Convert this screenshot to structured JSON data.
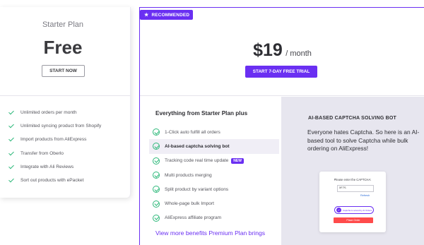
{
  "starter": {
    "name": "Starter Plan",
    "price": "Free",
    "button": "START NOW",
    "features": [
      "Unlimited orders per month",
      "Unlimited syncing product from Shopify",
      "Import products from AliExpress",
      "Transfer from Oberlo",
      "Integrate with Ali Reviews",
      "Sort out products with ePacket"
    ]
  },
  "premium": {
    "badge": "RECOMMENDED",
    "price": "$19",
    "per": "/ month",
    "button": "START 7-DAY FREE TRIAL",
    "plus_title": "Everything from Starter Plan plus",
    "features": [
      {
        "label": "1-Click auto fulfill all orders"
      },
      {
        "label": "AI-based captcha solving bot"
      },
      {
        "label": "Tracking code real time update",
        "tag": "NEW"
      },
      {
        "label": "Multi products merging"
      },
      {
        "label": "Split product by variant options"
      },
      {
        "label": "Whole-page bulk Import"
      },
      {
        "label": "AliExpress affiliate program"
      }
    ],
    "more_link": "View more benefits Premium Plan brings"
  },
  "ai_panel": {
    "title": "AI-BASED CAPTCHA SOLVING BOT",
    "description": "Everyone hates Captcha. So here is an AI-based tool to solve Captcha while bulk ordering on AliExpress!",
    "mock": {
      "label": "Please enter the CAPTCHA:",
      "input_value": "XF75",
      "refresh": "Refresh",
      "solved": "Captcha is solved by AI Orders",
      "order_button": "Place Order"
    }
  },
  "colors": {
    "accent": "#6a2ff2",
    "check": "#2db87a",
    "panel_bg": "#e7e6ef",
    "order_button": "#ff4b4b"
  },
  "icons": [
    "check-icon",
    "circle-check-icon",
    "star-icon"
  ]
}
